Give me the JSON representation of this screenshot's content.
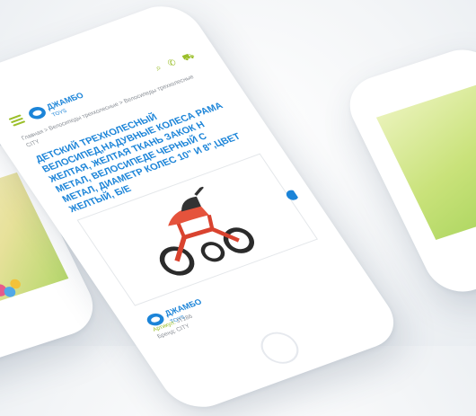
{
  "brand": {
    "logo_text": "ДЖАМБО",
    "logo_sub": "TOYS"
  },
  "breadcrumb": "Главная > Велосипеды трехколесные > Велосипеды трехколесные CITY",
  "product": {
    "title": "ДЕТСКИЙ ТРЕХКОЛЕСНЫЙ ВЕЛОСИПЕД,НАДУВНЫЕ КОЛЕСА РАМА ЖЕЛТАЯ, ЖЕЛТАЯ ТКАНЬ ЗАКОК Н МЕТАЛ, ВЕЛОСИПЕДЕ ЧЕРНЫЙ С МЕТАЛ, ДИАМЕТР КОЛЕС 10\" И 8\",ЦВЕТ ЖЕЛТЫЙ, Б/Е",
    "article_label": "Артикул:",
    "article_value": "JT186",
    "brand_line": "Бренд: CITY"
  },
  "colors": {
    "brand_blue": "#1b84d8",
    "accent_green": "#9bbf2a"
  },
  "icons": {
    "menu": "menu-icon",
    "search": "search-icon",
    "phone": "phone-icon",
    "cart": "cart-icon"
  }
}
